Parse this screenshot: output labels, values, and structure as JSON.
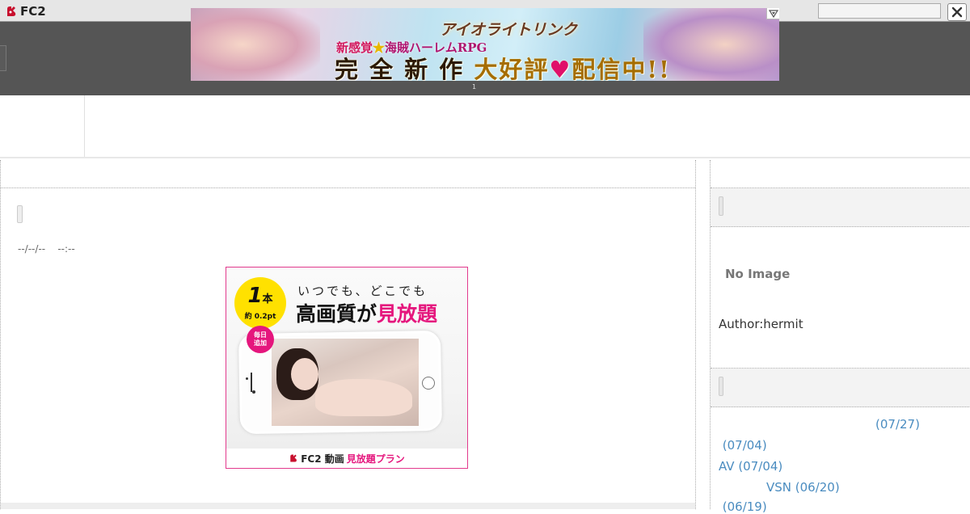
{
  "topbar": {
    "logo_text": "FC2",
    "search_placeholder": "",
    "close_icon": "close-icon"
  },
  "banner": {
    "brand": "アイオライトリンク",
    "subtitle_a": "新感覚",
    "subtitle_star": "★",
    "subtitle_b": "海賊ハーレムRPG",
    "headline_a": "完 全 新 作 ",
    "headline_b": "大好評",
    "headline_heart": "♥",
    "headline_c": "配信中!!",
    "index": "1"
  },
  "entry": {
    "date": "--/--/--    --:--"
  },
  "ad": {
    "count_big": "1",
    "count_unit": "本",
    "price": "約 0.2pt",
    "daily_badge": "毎日\n追加",
    "tagline_small": "いつでも、どこでも",
    "tagline_big_a": "高画質が",
    "tagline_big_b": "見放題",
    "footer_a": "FC2 動画",
    "footer_b": "見放題プラン"
  },
  "sidebar": {
    "no_image": "No Image",
    "author": "Author:hermit",
    "recent_entries": [
      "(07/27)",
      " (07/04)",
      "AV (07/04)",
      "VSN (06/20)",
      " (06/19)"
    ]
  }
}
